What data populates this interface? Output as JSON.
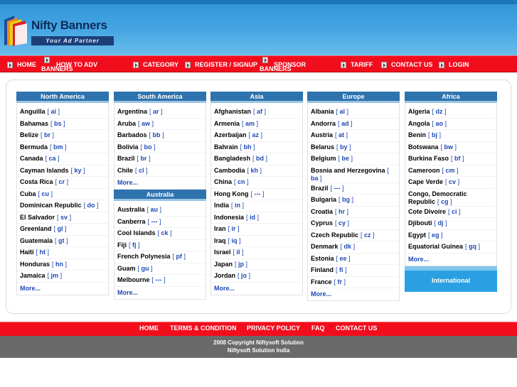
{
  "brand": {
    "name": "Nifty Banners",
    "tagline": "Your Ad Partner"
  },
  "nav": {
    "items": [
      {
        "label": "HOME"
      },
      {
        "label": "HOW TO ADV",
        "label2": "BANNERS"
      },
      {
        "label": "CATEGORY"
      },
      {
        "label": "REGISTER / SIGNUP"
      },
      {
        "label": "SPONSOR",
        "label2": "BANNERS"
      },
      {
        "label": "TARIFF"
      },
      {
        "label": "CONTACT US"
      },
      {
        "label": "LOGIN"
      }
    ]
  },
  "regions": {
    "north_america": {
      "title": "North America",
      "countries": [
        {
          "name": "Anguilla",
          "code": "ai"
        },
        {
          "name": "Bahamas",
          "code": "bs"
        },
        {
          "name": "Belize",
          "code": "br"
        },
        {
          "name": "Bermuda",
          "code": "bm"
        },
        {
          "name": "Canada",
          "code": "ca"
        },
        {
          "name": "Cayman Islands",
          "code": "ky"
        },
        {
          "name": "Costa Rica",
          "code": "cr"
        },
        {
          "name": "Cuba",
          "code": "cu"
        },
        {
          "name": "Dominican Republic",
          "code": "do"
        },
        {
          "name": "El Salvador",
          "code": "sv"
        },
        {
          "name": "Greenland",
          "code": "gl"
        },
        {
          "name": "Guatemala",
          "code": "gt"
        },
        {
          "name": "Haiti",
          "code": "ht"
        },
        {
          "name": "Honduras",
          "code": "hn"
        },
        {
          "name": "Jamaica",
          "code": "jm"
        }
      ],
      "more": "More..."
    },
    "south_america": {
      "title": "South America",
      "countries": [
        {
          "name": "Argentina",
          "code": "ar"
        },
        {
          "name": "Aruba",
          "code": "aw"
        },
        {
          "name": "Barbados",
          "code": "bb"
        },
        {
          "name": "Bolivia",
          "code": "bo"
        },
        {
          "name": "Brazil",
          "code": "br"
        },
        {
          "name": "Chile",
          "code": "cl"
        }
      ],
      "more": "More..."
    },
    "australia": {
      "title": "Australia",
      "countries": [
        {
          "name": "Australia",
          "code": "au"
        },
        {
          "name": "Canberra",
          "code": "---"
        },
        {
          "name": "Cool Islands",
          "code": "ck"
        },
        {
          "name": "Fiji",
          "code": "fj"
        },
        {
          "name": "French Polynesia",
          "code": "pf"
        },
        {
          "name": "Guam",
          "code": "gu"
        },
        {
          "name": "Melbourne",
          "code": "---"
        }
      ],
      "more": "More..."
    },
    "asia": {
      "title": "Asia",
      "countries": [
        {
          "name": "Afghanistan",
          "code": "af"
        },
        {
          "name": "Armenia",
          "code": "am"
        },
        {
          "name": "Azerbaijan",
          "code": "az"
        },
        {
          "name": "Bahrain",
          "code": "bh"
        },
        {
          "name": "Bangladesh",
          "code": "bd"
        },
        {
          "name": "Cambodia",
          "code": "kh"
        },
        {
          "name": "China",
          "code": "cn"
        },
        {
          "name": "Hong Kong",
          "code": "---"
        },
        {
          "name": "India",
          "code": "in"
        },
        {
          "name": "Indonesia",
          "code": "id"
        },
        {
          "name": "Iran",
          "code": "ir"
        },
        {
          "name": "Iraq",
          "code": "iq"
        },
        {
          "name": "Israel",
          "code": "il"
        },
        {
          "name": "Japan",
          "code": "jp"
        },
        {
          "name": "Jordan",
          "code": "jo"
        }
      ],
      "more": "More..."
    },
    "europe": {
      "title": "Europe",
      "countries": [
        {
          "name": "Albania",
          "code": "al"
        },
        {
          "name": "Andorra",
          "code": "ad"
        },
        {
          "name": "Austria",
          "code": "at"
        },
        {
          "name": "Belarus",
          "code": "by"
        },
        {
          "name": "Belgium",
          "code": "be"
        },
        {
          "name": "Bosnia and Herzegovina",
          "code": "ba"
        },
        {
          "name": "Brazil",
          "code": "---"
        },
        {
          "name": "Bulgaria",
          "code": "bg"
        },
        {
          "name": "Croatia",
          "code": "hr"
        },
        {
          "name": "Cyprus",
          "code": "cy"
        },
        {
          "name": "Czech Republic",
          "code": "cz"
        },
        {
          "name": "Denmark",
          "code": "dk"
        },
        {
          "name": "Estonia",
          "code": "ee"
        },
        {
          "name": "Finland",
          "code": "fi"
        },
        {
          "name": "France",
          "code": "fr"
        }
      ],
      "more": "More..."
    },
    "africa": {
      "title": "Africa",
      "countries": [
        {
          "name": "Algeria",
          "code": "dz"
        },
        {
          "name": "Angola",
          "code": "ao"
        },
        {
          "name": "Benin",
          "code": "bj"
        },
        {
          "name": "Botswana",
          "code": "bw"
        },
        {
          "name": "Burkina Faso",
          "code": "bf"
        },
        {
          "name": "Cameroon",
          "code": "cm"
        },
        {
          "name": "Cape Verde",
          "code": "cv"
        },
        {
          "name": "Congo, Democratic Republic",
          "code": "cg"
        },
        {
          "name": "Cote Divoire",
          "code": "ci"
        },
        {
          "name": "Djibouti",
          "code": "dj"
        },
        {
          "name": "Egypt",
          "code": "eg"
        },
        {
          "name": "Equatorial Guinea",
          "code": "gq"
        }
      ],
      "more": "More..."
    },
    "international": {
      "title": "International"
    }
  },
  "footer": {
    "links": [
      "HOME",
      "TERMS & CONDITION",
      "PRIVACY POLICY",
      "FAQ",
      "CONTACT US"
    ],
    "copyright": "2008 Copyright Niftysoft Solution",
    "company": "Niftysoft Solution India"
  },
  "colors": {
    "nav_red": "#f20d1d",
    "header_blue": "#2f93d7",
    "region_blue": "#2e73ae",
    "link_blue": "#1f49b5",
    "footer_gray": "#6a6a6a"
  }
}
